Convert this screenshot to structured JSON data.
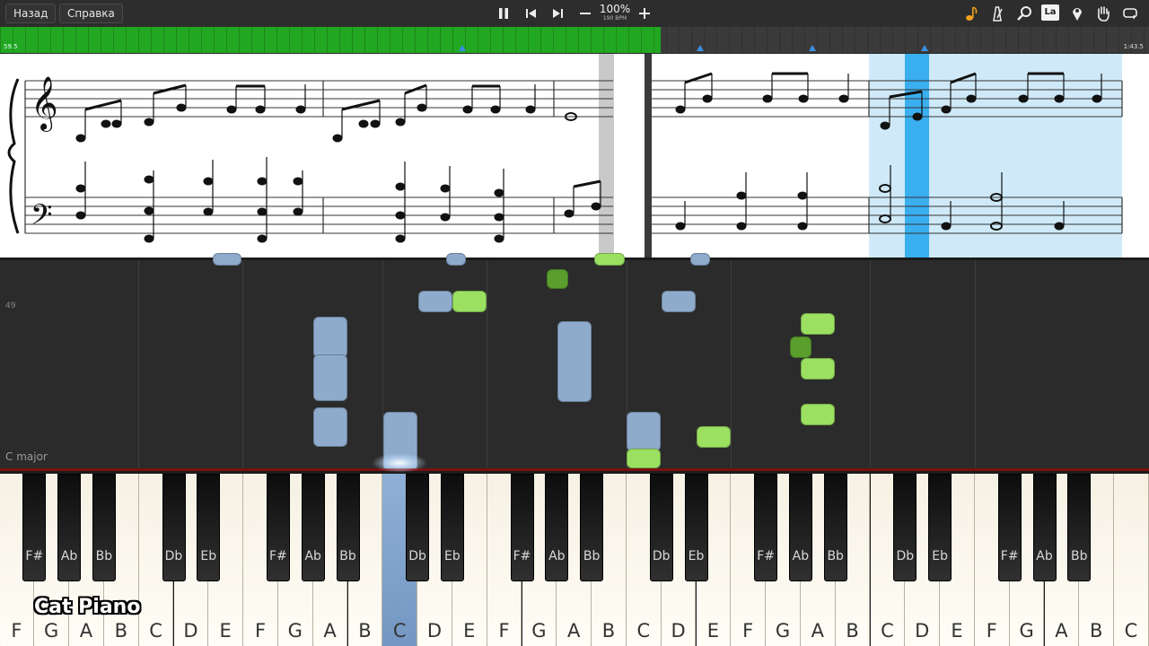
{
  "toolbar": {
    "back_label": "Назад",
    "help_label": "Справка",
    "tempo_percent": "100%",
    "tempo_bpm": "190 BPM",
    "la_label": "La",
    "icons": [
      "pause-icon",
      "skip-back-icon",
      "skip-forward-icon",
      "minus-icon",
      "plus-icon",
      "note-icon",
      "metronome-icon",
      "magnifier-icon",
      "la-icon",
      "pin-icon",
      "hand-icon",
      "loop-icon"
    ]
  },
  "progress": {
    "played_fraction": 0.575,
    "time_start": "59.5",
    "time_end": "1:43.5"
  },
  "roll": {
    "row_label": "49",
    "key_label": "C major"
  },
  "keyboard": {
    "white_labels": [
      "F",
      "G",
      "A",
      "B",
      "C",
      "D",
      "E",
      "F",
      "G",
      "A",
      "B",
      "C",
      "D",
      "E",
      "F",
      "G",
      "A",
      "B",
      "C",
      "D",
      "E",
      "F",
      "G",
      "A",
      "B",
      "C",
      "D",
      "E",
      "F",
      "G",
      "A",
      "B",
      "C"
    ],
    "black_labels": [
      "F#",
      "Ab",
      "Bb",
      "Db",
      "Eb",
      "F#",
      "Ab",
      "Bb",
      "Db",
      "Eb",
      "F#",
      "Ab",
      "Bb",
      "Db",
      "Eb",
      "F#",
      "Ab",
      "Bb",
      "Db",
      "Eb",
      "F#",
      "Ab",
      "Bb",
      "Db"
    ],
    "active_white_index": 11
  },
  "brand": "Cat Piano",
  "colors": {
    "played": "#22a722",
    "note_blue": "#8eabcc",
    "note_green": "#9be060",
    "highlight": "#cfe9f8",
    "cursor": "#3aaff0"
  }
}
